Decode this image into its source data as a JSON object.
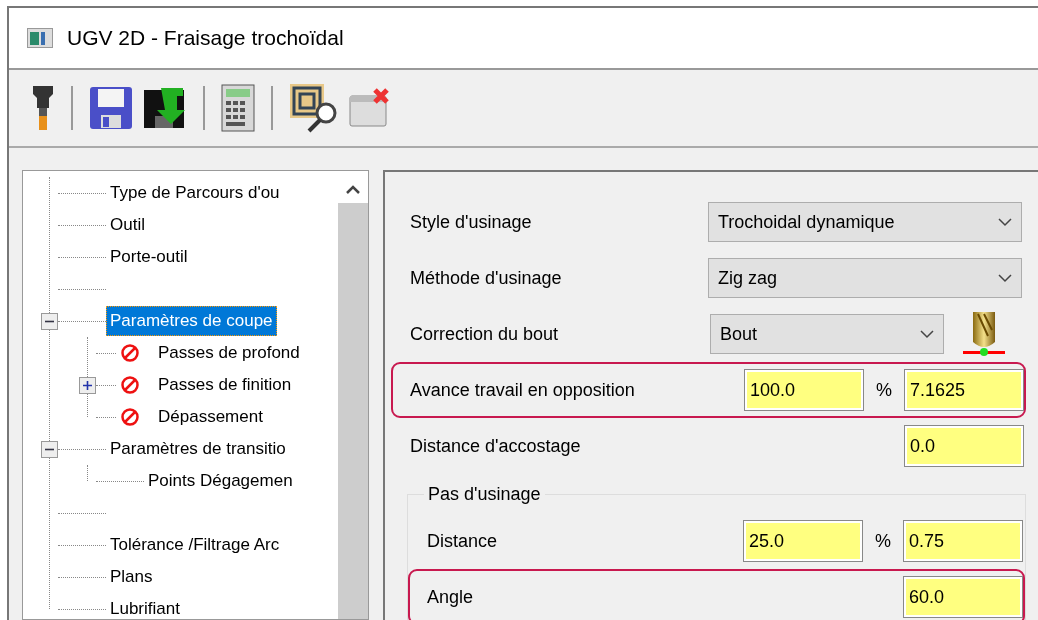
{
  "window": {
    "title": "UGV 2D - Fraisage trochoïdal"
  },
  "tree": {
    "items": [
      {
        "kind": "node",
        "label": "Type de Parcours d'ou",
        "selected": false
      },
      {
        "kind": "node",
        "label": "Outil",
        "selected": false
      },
      {
        "kind": "node",
        "label": "Porte-outil",
        "selected": false
      },
      {
        "kind": "blank"
      },
      {
        "kind": "node",
        "label": "Paramètres de coupe",
        "selected": true,
        "expanded": true,
        "children": [
          {
            "kind": "node",
            "label": "Passes de profond",
            "selected": false,
            "invalid": true
          },
          {
            "kind": "node",
            "label": "Passes de finition",
            "selected": false,
            "invalid": true,
            "expanded": false
          },
          {
            "kind": "node",
            "label": "Dépassement",
            "selected": false,
            "invalid": true
          }
        ]
      },
      {
        "kind": "node",
        "label": "Paramètres de transitio",
        "selected": false,
        "expanded": true,
        "children": [
          {
            "kind": "node",
            "label": "Points Dégagemen",
            "selected": false
          }
        ]
      },
      {
        "kind": "blank"
      },
      {
        "kind": "node",
        "label": "Tolérance /Filtrage Arc",
        "selected": false
      },
      {
        "kind": "node",
        "label": "Plans",
        "selected": false
      },
      {
        "kind": "node",
        "label": "Lubrifiant",
        "selected": false
      }
    ]
  },
  "form": {
    "rows": [
      {
        "kind": "select",
        "label": "Style d'usinage",
        "value": "Trochoidal dynamique",
        "highlighted": false
      },
      {
        "kind": "select",
        "label": "Méthode d'usinage",
        "value": "Zig zag",
        "highlighted": false
      },
      {
        "kind": "select-tool",
        "label": "Correction du bout",
        "value": "Bout",
        "highlighted": false
      },
      {
        "kind": "percent",
        "label": "Avance travail en opposition",
        "percent": "100.0",
        "unit": "%",
        "value": "7.1625",
        "highlighted": true
      },
      {
        "kind": "field",
        "label": "Distance d'accostage",
        "value": "0.0",
        "highlighted": false
      }
    ],
    "group": {
      "title": "Pas d'usinage",
      "rows": [
        {
          "kind": "percent",
          "label": "Distance",
          "percent": "25.0",
          "unit": "%",
          "value": "0.75",
          "highlighted": false
        },
        {
          "kind": "field",
          "label": "Angle",
          "value": "60.0",
          "highlighted": true
        }
      ]
    }
  }
}
